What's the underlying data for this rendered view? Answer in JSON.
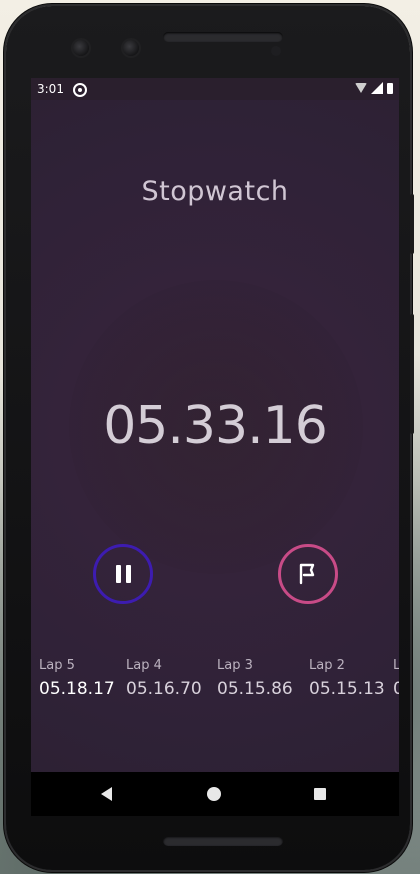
{
  "status_bar": {
    "time": "3:01"
  },
  "app": {
    "title": "Stopwatch"
  },
  "stopwatch": {
    "elapsed": "05.33.16"
  },
  "laps": [
    {
      "label": "Lap 5",
      "time": "05.18.17"
    },
    {
      "label": "Lap 4",
      "time": "05.16.70"
    },
    {
      "label": "Lap 3",
      "time": "05.15.86"
    },
    {
      "label": "Lap 2",
      "time": "05.15.13"
    },
    {
      "label": "L",
      "time": "0"
    }
  ],
  "colors": {
    "pause_ring": "#3d1cb0",
    "lap_ring": "#c84b87",
    "background": "#34233a"
  },
  "icons": {
    "pause": "pause-icon",
    "lap": "flag-icon",
    "back": "back-icon",
    "home": "home-icon",
    "recents": "recents-icon"
  }
}
